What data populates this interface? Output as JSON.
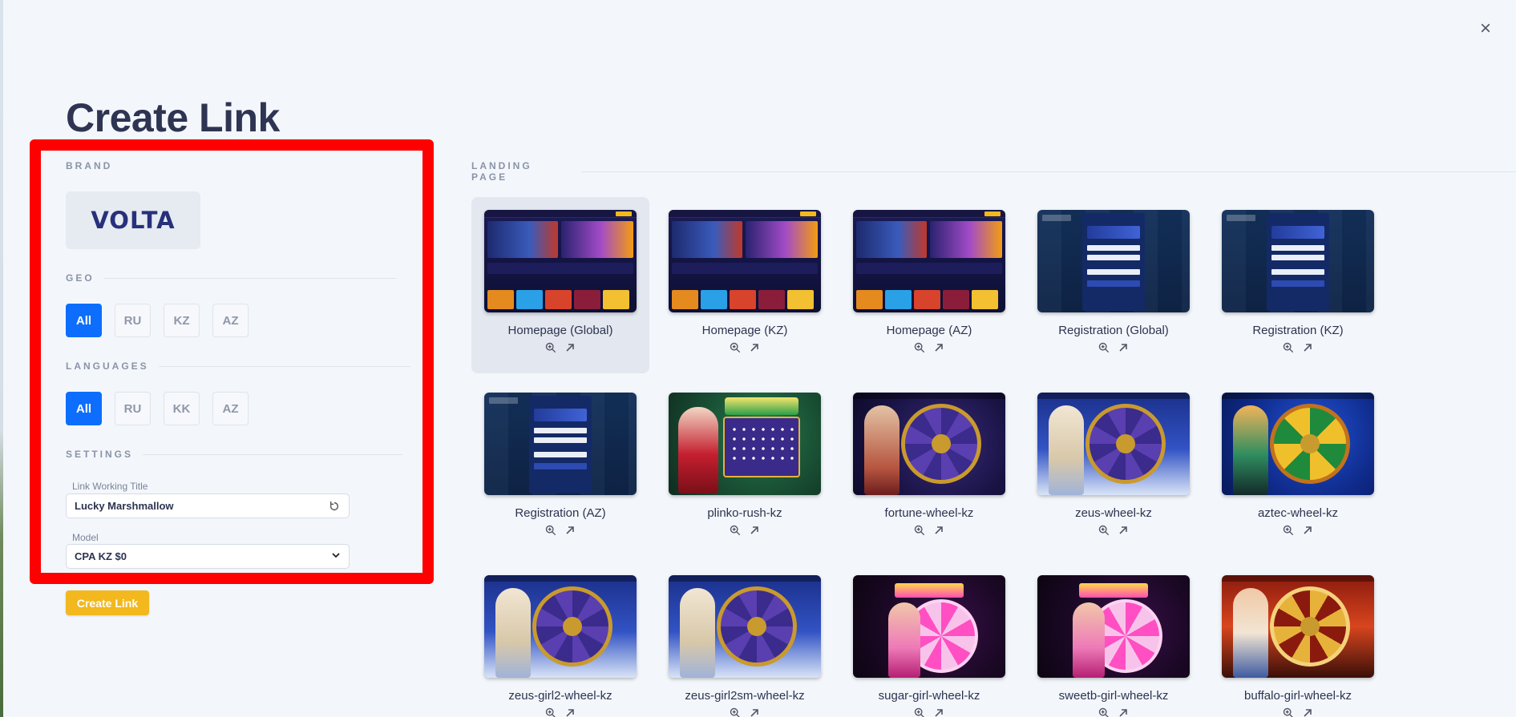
{
  "page": {
    "title": "Create Link",
    "close_glyph": "×"
  },
  "brand": {
    "label": "BRAND",
    "logo_text": "VOLTA",
    "selected": true
  },
  "geo": {
    "label": "GEO",
    "options": [
      "All",
      "RU",
      "KZ",
      "AZ"
    ],
    "selected": "All"
  },
  "languages": {
    "label": "LANGUAGES",
    "options": [
      "All",
      "RU",
      "KK",
      "AZ"
    ],
    "selected": "All"
  },
  "settings": {
    "label": "SETTINGS",
    "link_title_label": "Link Working Title",
    "link_title_value": "Lucky Marshmallow",
    "model_label": "Model",
    "model_value": "CPA KZ $0"
  },
  "actions": {
    "create_label": "Create Link"
  },
  "landing": {
    "label": "LANDING PAGE",
    "selected": "Homepage (Global)",
    "pages": [
      {
        "title": "Homepage (Global)",
        "art": "home"
      },
      {
        "title": "Homepage (KZ)",
        "art": "home"
      },
      {
        "title": "Homepage (AZ)",
        "art": "home"
      },
      {
        "title": "Registration (Global)",
        "art": "reg"
      },
      {
        "title": "Registration (KZ)",
        "art": "reg"
      },
      {
        "title": "Registration (AZ)",
        "art": "reg"
      },
      {
        "title": "plinko-rush-kz",
        "art": "plinko"
      },
      {
        "title": "fortune-wheel-kz",
        "art": "wheel"
      },
      {
        "title": "zeus-wheel-kz",
        "art": "zeus"
      },
      {
        "title": "aztec-wheel-kz",
        "art": "aztec"
      },
      {
        "title": "zeus-girl2-wheel-kz",
        "art": "zeus"
      },
      {
        "title": "zeus-girl2sm-wheel-kz",
        "art": "zeus"
      },
      {
        "title": "sugar-girl-wheel-kz",
        "art": "sugar"
      },
      {
        "title": "sweetb-girl-wheel-kz",
        "art": "sugar"
      },
      {
        "title": "buffalo-girl-wheel-kz",
        "art": "buffalo"
      }
    ]
  },
  "colors": {
    "accent": "#0d6efd",
    "create_button": "#f2b81e",
    "highlight": "#ff0000",
    "title": "#2e3452"
  },
  "icons": {
    "close": "close-icon",
    "reset": "reset-icon",
    "zoom": "zoom-in-icon",
    "open": "open-external-icon",
    "dropdown": "chevron-down-icon"
  }
}
